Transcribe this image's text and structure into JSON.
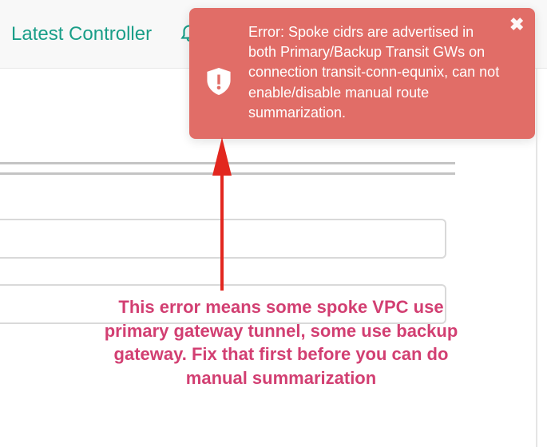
{
  "topbar": {
    "title": "Latest Controller"
  },
  "alert": {
    "message": "Error: Spoke cidrs are advertised in both Primary/Backup Transit GWs on connection transit-conn-equnix, can not enable/disable manual route summarization.",
    "close_glyph": "✖"
  },
  "annotation": {
    "text": "This error means some spoke VPC use primary gateway tunnel, some use backup gateway. Fix that first before you can do manual summarization"
  },
  "colors": {
    "accent": "#1a9e88",
    "alert_bg": "#e16d67",
    "annotation_fg": "#d23f72"
  }
}
